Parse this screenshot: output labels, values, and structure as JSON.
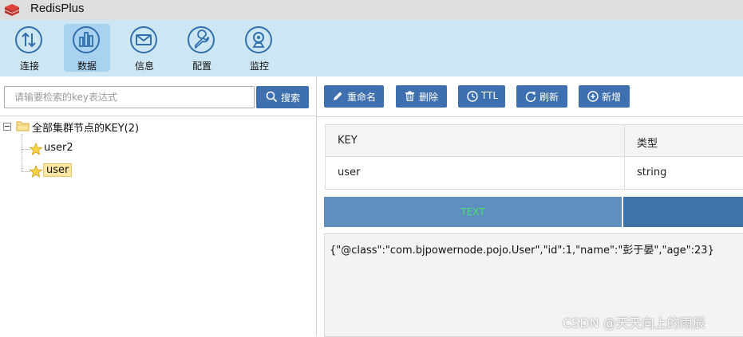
{
  "app": {
    "title": "RedisPlus"
  },
  "toolbar": {
    "items": [
      {
        "label": "连接",
        "icon": "connection-arrows-icon"
      },
      {
        "label": "数据",
        "icon": "data-bars-icon",
        "active": true
      },
      {
        "label": "信息",
        "icon": "mail-icon"
      },
      {
        "label": "配置",
        "icon": "wrench-icon"
      },
      {
        "label": "监控",
        "icon": "webcam-icon"
      }
    ]
  },
  "search": {
    "placeholder": "请输要检索的key表达式",
    "button_label": "搜索"
  },
  "tree": {
    "root_label": "全部集群节点的KEY(2)",
    "items": [
      {
        "label": "user2",
        "selected": false
      },
      {
        "label": "user",
        "selected": true
      }
    ]
  },
  "actions": {
    "rename": "重命名",
    "delete": "删除",
    "ttl": "TTL",
    "refresh": "刷新",
    "add": "新增"
  },
  "key_table": {
    "headers": [
      "KEY",
      "类型"
    ],
    "row": [
      "user",
      "string"
    ]
  },
  "value_tabs": {
    "text_tab": "TEXT"
  },
  "value": "{\"@class\":\"com.bjpowernode.pojo.User\",\"id\":1,\"name\":\"彭于晏\",\"age\":23}",
  "watermark": "CSDN @天天向上的雨辰",
  "colors": {
    "button_blue": "#3e6fae",
    "toolbar_bg": "#cde6f4",
    "tab_text_green": "#42e36a"
  }
}
